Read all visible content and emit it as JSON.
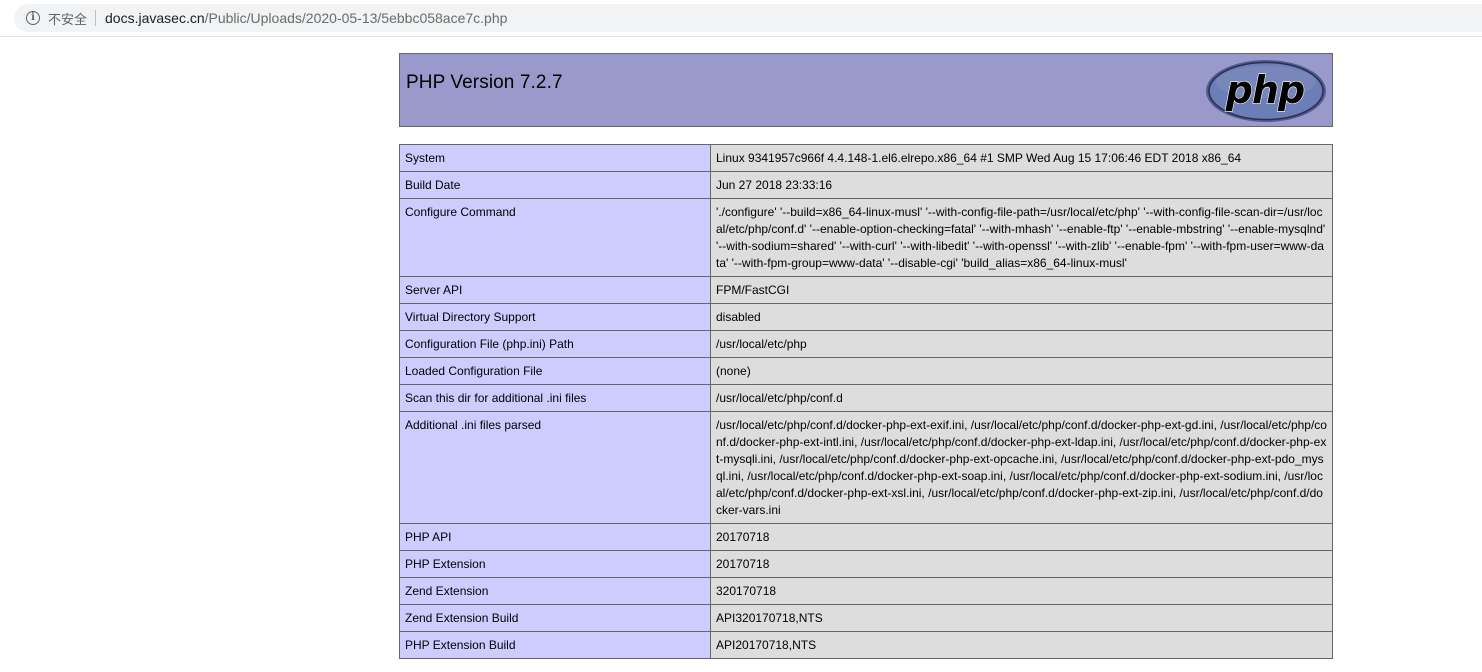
{
  "browser": {
    "security_icon": "info-icon",
    "security_label": "不安全",
    "url_host": "docs.javasec.cn",
    "url_path": "/Public/Uploads/2020-05-13/5ebbc058ace7c.php"
  },
  "header": {
    "title": "PHP Version 7.2.7",
    "logo_text": "php"
  },
  "rows": [
    {
      "key": "System",
      "value": "Linux 9341957c966f 4.4.148-1.el6.elrepo.x86_64 #1 SMP Wed Aug 15 17:06:46 EDT 2018 x86_64"
    },
    {
      "key": "Build Date",
      "value": "Jun 27 2018 23:33:16"
    },
    {
      "key": "Configure Command",
      "value": "'./configure' '--build=x86_64-linux-musl' '--with-config-file-path=/usr/local/etc/php' '--with-config-file-scan-dir=/usr/local/etc/php/conf.d' '--enable-option-checking=fatal' '--with-mhash' '--enable-ftp' '--enable-mbstring' '--enable-mysqlnd' '--with-sodium=shared' '--with-curl' '--with-libedit' '--with-openssl' '--with-zlib' '--enable-fpm' '--with-fpm-user=www-data' '--with-fpm-group=www-data' '--disable-cgi' 'build_alias=x86_64-linux-musl'"
    },
    {
      "key": "Server API",
      "value": "FPM/FastCGI"
    },
    {
      "key": "Virtual Directory Support",
      "value": "disabled"
    },
    {
      "key": "Configuration File (php.ini) Path",
      "value": "/usr/local/etc/php"
    },
    {
      "key": "Loaded Configuration File",
      "value": "(none)"
    },
    {
      "key": "Scan this dir for additional .ini files",
      "value": "/usr/local/etc/php/conf.d"
    },
    {
      "key": "Additional .ini files parsed",
      "value": "/usr/local/etc/php/conf.d/docker-php-ext-exif.ini, /usr/local/etc/php/conf.d/docker-php-ext-gd.ini, /usr/local/etc/php/conf.d/docker-php-ext-intl.ini, /usr/local/etc/php/conf.d/docker-php-ext-ldap.ini, /usr/local/etc/php/conf.d/docker-php-ext-mysqli.ini, /usr/local/etc/php/conf.d/docker-php-ext-opcache.ini, /usr/local/etc/php/conf.d/docker-php-ext-pdo_mysql.ini, /usr/local/etc/php/conf.d/docker-php-ext-soap.ini, /usr/local/etc/php/conf.d/docker-php-ext-sodium.ini, /usr/local/etc/php/conf.d/docker-php-ext-xsl.ini, /usr/local/etc/php/conf.d/docker-php-ext-zip.ini, /usr/local/etc/php/conf.d/docker-vars.ini"
    },
    {
      "key": "PHP API",
      "value": "20170718"
    },
    {
      "key": "PHP Extension",
      "value": "20170718"
    },
    {
      "key": "Zend Extension",
      "value": "320170718"
    },
    {
      "key": "Zend Extension Build",
      "value": "API320170718,NTS"
    },
    {
      "key": "PHP Extension Build",
      "value": "API20170718,NTS"
    }
  ],
  "colors": {
    "header_bg": "#9999cc",
    "key_bg": "#ccccff",
    "value_bg": "#dddddd",
    "border": "#666666",
    "logo_fill": "#6c7eb7"
  }
}
